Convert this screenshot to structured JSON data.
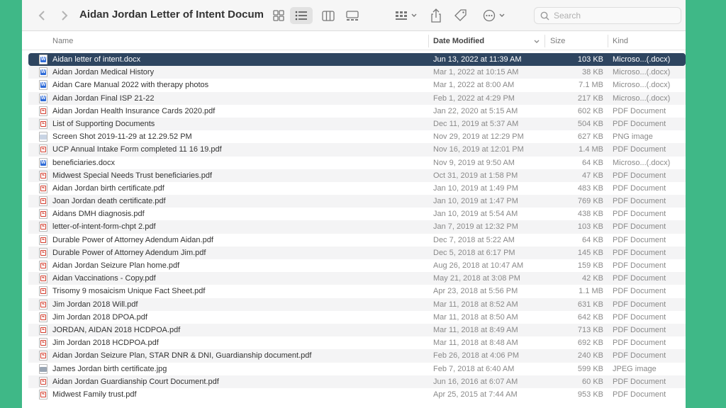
{
  "window": {
    "title": "Aidan Jordan Letter of Intent Docume...",
    "search_placeholder": "Search"
  },
  "columns": {
    "name": "Name",
    "date": "Date Modified",
    "size": "Size",
    "kind": "Kind"
  },
  "files": [
    {
      "name": "Aidan letter of intent.docx",
      "date": "Jun 13, 2022 at 11:39 AM",
      "size": "103 KB",
      "kind": "Microso...(.docx)",
      "icon": "word-doc-icon",
      "selected": true
    },
    {
      "name": "Aidan Jordan Medical History",
      "date": "Mar 1, 2022 at 10:15 AM",
      "size": "38 KB",
      "kind": "Microso...(.docx)",
      "icon": "word-doc-icon"
    },
    {
      "name": "Aidan Care Manual 2022 with therapy photos",
      "date": "Mar 1, 2022 at 8:00 AM",
      "size": "7.1 MB",
      "kind": "Microso...(.docx)",
      "icon": "word-doc-icon"
    },
    {
      "name": "Aidan Jordan Final ISP 21-22",
      "date": "Feb 1, 2022 at 4:29 PM",
      "size": "217 KB",
      "kind": "Microso...(.docx)",
      "icon": "word-doc-icon"
    },
    {
      "name": "Aidan Jordan Health Insurance Cards 2020.pdf",
      "date": "Jan 22, 2020 at 5:15 AM",
      "size": "602 KB",
      "kind": "PDF Document",
      "icon": "pdf-icon"
    },
    {
      "name": "List of Supporting Documents",
      "date": "Dec 11, 2019 at 5:37 AM",
      "size": "504 KB",
      "kind": "PDF Document",
      "icon": "pdf-icon"
    },
    {
      "name": "Screen Shot 2019-11-29 at 12.29.52 PM",
      "date": "Nov 29, 2019 at 12:29 PM",
      "size": "627 KB",
      "kind": "PNG image",
      "icon": "png-icon"
    },
    {
      "name": "UCP Annual Intake Form completed 11 16 19.pdf",
      "date": "Nov 16, 2019 at 12:01 PM",
      "size": "1.4 MB",
      "kind": "PDF Document",
      "icon": "pdf-icon"
    },
    {
      "name": "beneficiaries.docx",
      "date": "Nov 9, 2019 at 9:50 AM",
      "size": "64 KB",
      "kind": "Microso...(.docx)",
      "icon": "word-doc-icon"
    },
    {
      "name": "Midwest Special Needs Trust beneficiaries.pdf",
      "date": "Oct 31, 2019 at 1:58 PM",
      "size": "47 KB",
      "kind": "PDF Document",
      "icon": "pdf-icon"
    },
    {
      "name": "Aidan Jordan birth certificate.pdf",
      "date": "Jan 10, 2019 at 1:49 PM",
      "size": "483 KB",
      "kind": "PDF Document",
      "icon": "pdf-icon"
    },
    {
      "name": "Joan Jordan death certificate.pdf",
      "date": "Jan 10, 2019 at 1:47 PM",
      "size": "769 KB",
      "kind": "PDF Document",
      "icon": "pdf-icon"
    },
    {
      "name": "Aidans DMH diagnosis.pdf",
      "date": "Jan 10, 2019 at 5:54 AM",
      "size": "438 KB",
      "kind": "PDF Document",
      "icon": "pdf-icon"
    },
    {
      "name": "letter-of-intent-form-chpt 2.pdf",
      "date": "Jan 7, 2019 at 12:32 PM",
      "size": "103 KB",
      "kind": "PDF Document",
      "icon": "pdf-icon"
    },
    {
      "name": "Durable Power of Attorney Adendum Aidan.pdf",
      "date": "Dec 7, 2018 at 5:22 AM",
      "size": "64 KB",
      "kind": "PDF Document",
      "icon": "pdf-icon"
    },
    {
      "name": "Durable Power of Attorney Adendum Jim.pdf",
      "date": "Dec 5, 2018 at 6:17 PM",
      "size": "145 KB",
      "kind": "PDF Document",
      "icon": "pdf-icon"
    },
    {
      "name": "Aidan Jordan Seizure Plan home.pdf",
      "date": "Aug 26, 2018 at 10:47 AM",
      "size": "159 KB",
      "kind": "PDF Document",
      "icon": "pdf-icon"
    },
    {
      "name": "Aidan Vaccinations - Copy.pdf",
      "date": "May 21, 2018 at 3:08 PM",
      "size": "42 KB",
      "kind": "PDF Document",
      "icon": "pdf-icon"
    },
    {
      "name": "Trisomy 9 mosaicism Unique Fact Sheet.pdf",
      "date": "Apr 23, 2018 at 5:56 PM",
      "size": "1.1 MB",
      "kind": "PDF Document",
      "icon": "pdf-icon"
    },
    {
      "name": "Jim Jordan 2018 Will.pdf",
      "date": "Mar 11, 2018 at 8:52 AM",
      "size": "631 KB",
      "kind": "PDF Document",
      "icon": "pdf-icon"
    },
    {
      "name": "Jim Jordan 2018 DPOA.pdf",
      "date": "Mar 11, 2018 at 8:50 AM",
      "size": "642 KB",
      "kind": "PDF Document",
      "icon": "pdf-icon"
    },
    {
      "name": "JORDAN, AIDAN 2018 HCDPOA.pdf",
      "date": "Mar 11, 2018 at 8:49 AM",
      "size": "713 KB",
      "kind": "PDF Document",
      "icon": "pdf-icon"
    },
    {
      "name": "Jim Jordan 2018 HCDPOA.pdf",
      "date": "Mar 11, 2018 at 8:48 AM",
      "size": "692 KB",
      "kind": "PDF Document",
      "icon": "pdf-icon"
    },
    {
      "name": "Aidan Jordan Seizure Plan, STAR DNR & DNI, Guardianship document.pdf",
      "date": "Feb 26, 2018 at 4:06 PM",
      "size": "240 KB",
      "kind": "PDF Document",
      "icon": "pdf-icon"
    },
    {
      "name": "James Jordan birth certificate.jpg",
      "date": "Feb 7, 2018 at 6:40 AM",
      "size": "599 KB",
      "kind": "JPEG image",
      "icon": "jpg-icon"
    },
    {
      "name": "Aidan Jordan Guardianship Court Document.pdf",
      "date": "Jun 16, 2016 at 6:07 AM",
      "size": "60 KB",
      "kind": "PDF Document",
      "icon": "pdf-icon"
    },
    {
      "name": "Midwest Family trust.pdf",
      "date": "Apr 25, 2015 at 7:44 AM",
      "size": "953 KB",
      "kind": "PDF Document",
      "icon": "pdf-icon"
    }
  ]
}
